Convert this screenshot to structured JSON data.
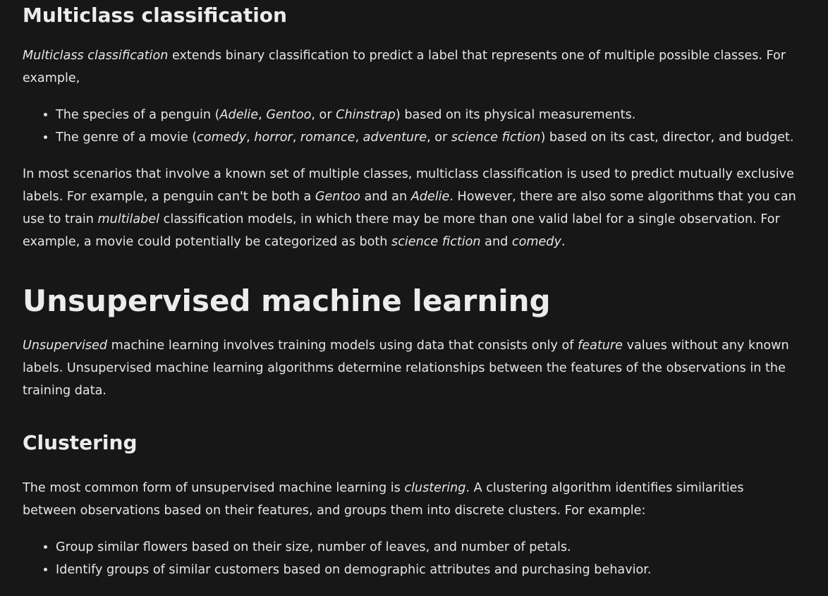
{
  "multiclass": {
    "heading": "Multiclass classification",
    "intro": {
      "term": "Multiclass classification",
      "rest": " extends binary classification to predict a label that represents one of multiple possible classes. For example,"
    },
    "examples": [
      {
        "a": "The species of a penguin (",
        "b1": "Adelie",
        "c1": ", ",
        "b2": "Gentoo",
        "c2": ", or ",
        "b3": "Chinstrap",
        "d": ") based on its physical measurements."
      },
      {
        "a": "The genre of a movie (",
        "b1": "comedy",
        "c1": ", ",
        "b2": "horror",
        "c2": ", ",
        "b3": "romance",
        "c3": ", ",
        "b4": "adventure",
        "c4": ", or ",
        "b5": "science fiction",
        "d": ") based on its cast, director, and budget."
      }
    ],
    "scenarios": {
      "s1": "In most scenarios that involve a known set of multiple classes, multiclass classification is used to predict mutually exclusive labels. For example, a penguin can't be both a ",
      "e1": "Gentoo",
      "s2": " and an ",
      "e2": "Adelie",
      "s3": ". However, there are also some algorithms that you can use to train ",
      "e3": "multilabel",
      "s4": " classification models, in which there may be more than one valid label for a single observation. For example, a movie could potentially be categorized as both ",
      "e4": "science fiction",
      "s5": " and ",
      "e5": "comedy",
      "s6": "."
    }
  },
  "unsupervised": {
    "heading": "Unsupervised machine learning",
    "term": "Unsupervised",
    "s1": " machine learning involves training models using data that consists only of ",
    "e1": "feature",
    "s2": " values without any known labels. Unsupervised machine learning algorithms determine relationships between the features of the observations in the training data."
  },
  "clustering": {
    "heading": "Clustering",
    "s1": "The most common form of unsupervised machine learning is ",
    "e1": "clustering",
    "s2": ". A clustering algorithm identifies similarities between observations based on their features, and groups them into discrete clusters. For example:",
    "examples": [
      "Group similar flowers based on their size, number of leaves, and number of petals.",
      "Identify groups of similar customers based on demographic attributes and purchasing behavior."
    ]
  }
}
